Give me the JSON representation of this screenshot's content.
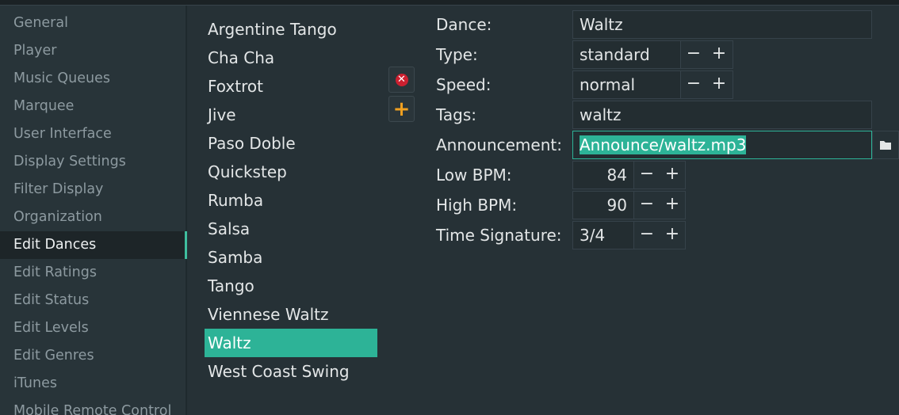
{
  "sidebar": {
    "items": [
      {
        "label": "General"
      },
      {
        "label": "Player"
      },
      {
        "label": "Music Queues"
      },
      {
        "label": "Marquee"
      },
      {
        "label": "User Interface"
      },
      {
        "label": "Display Settings"
      },
      {
        "label": "Filter Display"
      },
      {
        "label": "Organization"
      },
      {
        "label": "Edit Dances",
        "active": true
      },
      {
        "label": "Edit Ratings"
      },
      {
        "label": "Edit Status"
      },
      {
        "label": "Edit Levels"
      },
      {
        "label": "Edit Genres"
      },
      {
        "label": "iTunes"
      },
      {
        "label": "Mobile Remote Control"
      }
    ]
  },
  "dances": {
    "items": [
      "Argentine Tango",
      "Cha Cha",
      "Foxtrot",
      "Jive",
      "Paso Doble",
      "Quickstep",
      "Rumba",
      "Salsa",
      "Samba",
      "Tango",
      "Viennese Waltz",
      "Waltz",
      "West Coast Swing"
    ],
    "selected": "Waltz"
  },
  "toolbar": {
    "delete_icon": "delete-icon",
    "add_icon": "add-icon"
  },
  "form": {
    "dance": {
      "label": "Dance:",
      "value": "Waltz"
    },
    "type": {
      "label": "Type:",
      "value": "standard"
    },
    "speed": {
      "label": "Speed:",
      "value": "normal"
    },
    "tags": {
      "label": "Tags:",
      "value": "waltz"
    },
    "announcement": {
      "label": "Announcement:",
      "value": "Announce/waltz.mp3"
    },
    "low_bpm": {
      "label": "Low BPM:",
      "value": "84"
    },
    "high_bpm": {
      "label": "High BPM:",
      "value": "90"
    },
    "time_signature": {
      "label": "Time Signature:",
      "value": "3/4"
    },
    "minus": "−",
    "plus": "+"
  },
  "colors": {
    "accent": "#2db397",
    "background": "#263136",
    "delete": "#cc2030",
    "add": "#f0a020"
  }
}
